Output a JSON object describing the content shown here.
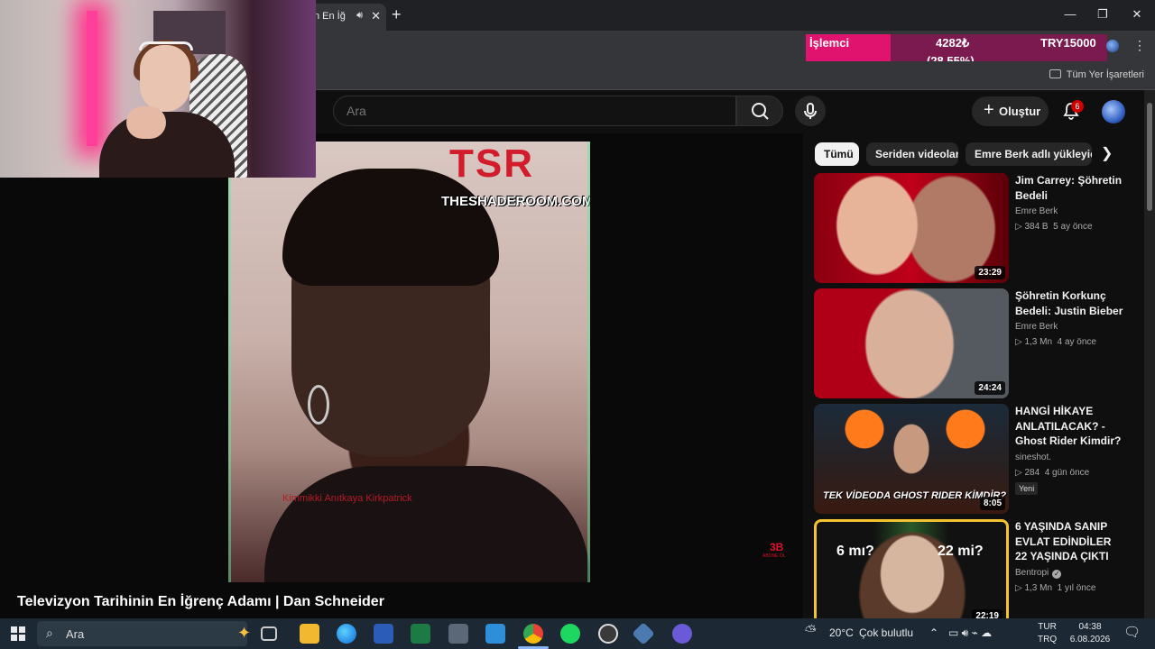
{
  "browser": {
    "tab_title": "n En İğ",
    "bookmarks_label": "Tüm Yer İşaretleri"
  },
  "stock_widget": {
    "label": "İşlemci",
    "value": "4282₺",
    "change": "(28.55%)",
    "currency_value": "TRY15000",
    "fill_fraction": 0.28
  },
  "header": {
    "search_placeholder": "Ara",
    "create_label": "Oluştur",
    "notification_count": "6"
  },
  "video": {
    "title": "Televizyon Tarihinin En İğrenç Adamı | Dan Schneider",
    "overlay_logo": "TSR",
    "overlay_site": "THESHADEROOM.COM",
    "overlay_sub": "Kimmikki Anıtkaya Kirkpatrick",
    "channel_watermark_number": "3B",
    "channel_watermark_text": "ABONE OL"
  },
  "chips": [
    {
      "label": "Tümü",
      "active": true
    },
    {
      "label": "Seriden videolar",
      "active": false
    },
    {
      "label": "Emre Berk adlı yükleyici",
      "active": false
    }
  ],
  "recommendations": [
    {
      "title": "Jim Carrey: Şöhretin Bedeli",
      "channel": "Emre Berk",
      "views": "384 B",
      "age": "5 ay önce",
      "duration": "23:29",
      "verified": false,
      "is_new": false
    },
    {
      "title": "Şöhretin Korkunç Bedeli: Justin Bieber",
      "channel": "Emre Berk",
      "views": "1,3 Mn",
      "age": "4 ay önce",
      "duration": "24:24",
      "verified": false,
      "is_new": false
    },
    {
      "title": "HANGİ HİKAYE ANLATILACAK? - Ghost Rider Kimdir?",
      "channel": "sineshot.",
      "views": "284",
      "age": "4 gün önce",
      "duration": "8:05",
      "verified": false,
      "is_new": true,
      "new_label": "Yeni",
      "thumb_text": "TEK VİDEODA GHOST RIDER KİMDİR?"
    },
    {
      "title": "6 YAŞINDA SANIP EVLAT EDİNDİLER 22 YAŞINDA ÇIKTI",
      "channel": "Bentropi",
      "views": "1,3 Mn",
      "age": "1 yıl önce",
      "duration": "22:19",
      "verified": true,
      "is_new": false,
      "thumb_left": "6 mı?",
      "thumb_right": "22 mi?"
    }
  ],
  "taskbar": {
    "search_text": "Ara",
    "weather": "20°C",
    "weather_desc": "Çok bulutlu",
    "lang_top": "TUR",
    "lang_bottom": "TRQ",
    "time": "04:38",
    "date": "6.08.2026"
  }
}
